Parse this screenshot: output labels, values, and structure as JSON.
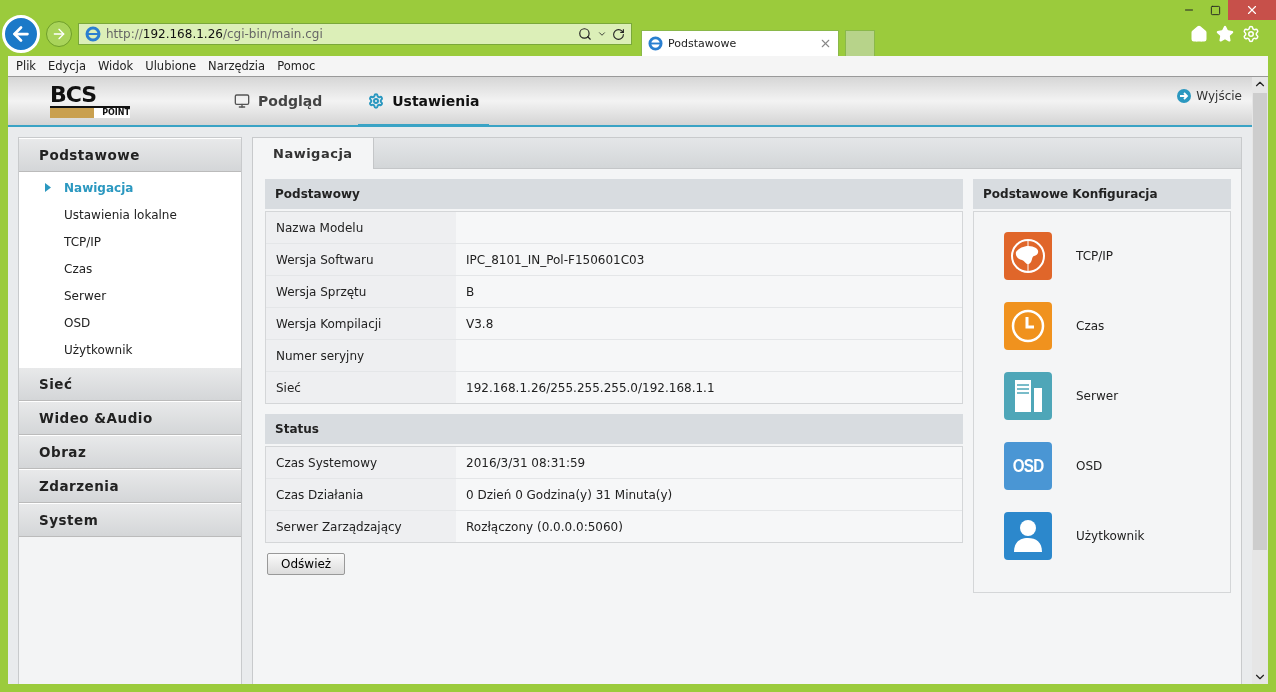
{
  "browser": {
    "url": {
      "scheme": "http://",
      "host": "192.168.1.26",
      "path": "/cgi-bin/main.cgi"
    },
    "tab": {
      "title": "Podstawowe"
    },
    "menu": [
      "Plik",
      "Edycja",
      "Widok",
      "Ulubione",
      "Narzędzia",
      "Pomoc"
    ]
  },
  "header": {
    "logo": {
      "top": "BCS",
      "bottom": "POINT"
    },
    "nav": [
      {
        "label": "Podgląd",
        "kind": "monitor",
        "selected": false
      },
      {
        "label": "Ustawienia",
        "kind": "gear",
        "selected": true
      }
    ],
    "logout": "Wyjście"
  },
  "sidebar": [
    {
      "title": "Podstawowe",
      "items": [
        {
          "label": "Nawigacja",
          "selected": true
        },
        {
          "label": "Ustawienia lokalne",
          "selected": false
        },
        {
          "label": "TCP/IP",
          "selected": false
        },
        {
          "label": "Czas",
          "selected": false
        },
        {
          "label": "Serwer",
          "selected": false
        },
        {
          "label": "OSD",
          "selected": false
        },
        {
          "label": "Użytkownik",
          "selected": false
        }
      ]
    },
    {
      "title": "Sieć"
    },
    {
      "title": "Wideo &Audio"
    },
    {
      "title": "Obraz"
    },
    {
      "title": "Zdarzenia"
    },
    {
      "title": "System"
    }
  ],
  "tabs": [
    {
      "label": "Nawigacja",
      "selected": true
    }
  ],
  "sections": [
    {
      "title": "Podstawowy",
      "rows": [
        {
          "label": "Nazwa Modelu",
          "value": ""
        },
        {
          "label": "Wersja Softwaru",
          "value": "IPC_8101_IN_Pol-F150601C03"
        },
        {
          "label": "Wersja Sprzętu",
          "value": "B"
        },
        {
          "label": "Wersja Kompilacji",
          "value": "V3.8"
        },
        {
          "label": "Numer seryjny",
          "value": ""
        },
        {
          "label": "Sieć",
          "value": "192.168.1.26/255.255.255.0/192.168.1.1"
        }
      ]
    },
    {
      "title": "Status",
      "rows": [
        {
          "label": "Czas Systemowy",
          "value": "2016/3/31 08:31:59"
        },
        {
          "label": "Czas Działania",
          "value": "0 Dzień 0 Godzina(y) 31 Minuta(y)"
        },
        {
          "label": "Serwer Zarządzający",
          "value": "Rozłączony (0.0.0.0:5060)"
        }
      ]
    }
  ],
  "refresh_button": "Odśwież",
  "quick_config": {
    "title": "Podstawowe Konfiguracja",
    "items": [
      {
        "kind": "globe",
        "label": "TCP/IP",
        "color": "#e0662a"
      },
      {
        "kind": "clock",
        "label": "Czas",
        "color": "#f0921e"
      },
      {
        "kind": "server",
        "label": "Serwer",
        "color": "#4ea6b8"
      },
      {
        "kind": "osd",
        "label": "OSD",
        "icon_text": "OSD",
        "color": "#4a96d4"
      },
      {
        "kind": "user",
        "label": "Użytkownik",
        "color": "#2c88cc"
      }
    ]
  }
}
